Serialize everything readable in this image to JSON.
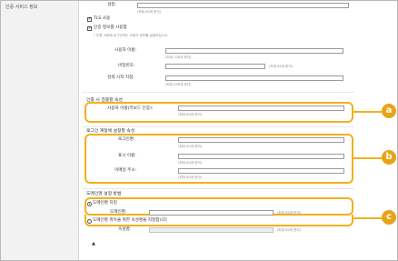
{
  "left_panel": {
    "label": "인증 서비스 정보"
  },
  "top": {
    "setting_label": "설정:",
    "setting_hint": "(최대 64개 문자)"
  },
  "tls": {
    "label": "TLS 사용",
    "checked": true
  },
  "auth_info": {
    "label": "인증 정보를 사용함",
    "checked": true,
    "note": "* 인증 서버에 로그인하는 사용자 정보를 설정하십시오.",
    "username_label": "사용자 이름:",
    "username_hint": "(최대 128개 문자)",
    "password_label": "비밀번호:",
    "password_hint": "(최대 64개 문자)",
    "search_start_label": "검색 시작 지점:",
    "search_start_hint": "(최대 256개 문자)"
  },
  "auth_attr": {
    "section_title": "인증 시 검증할 속성",
    "username_keyboard_label": "사용자 이름(키보드 인증):",
    "hint": "(최대 64개 문자)"
  },
  "login_account": {
    "section_title": "로그인 계정에 설정할 속성",
    "login_name_label": "로그인명:",
    "login_name_hint": "(최대 64개 문자)",
    "display_name_label": "표시 이름:",
    "display_name_hint": "(최대 64개 문자)",
    "email_label": "이메일 주소:",
    "email_hint": "(최대 64개 문자)"
  },
  "domain": {
    "section_title": "도메인명 설정 방법",
    "specify_label": "도메인명 지정",
    "specify_selected": true,
    "name_label": "도메인명:",
    "name_hint": "(최대 64개 문자)",
    "attr_option_label": "도메인명 취득을 위한 속성명을 지정합니다",
    "attr_selected": false,
    "attr_name_label": "속성명:",
    "attr_name_hint": "(최대 64개 문자)"
  },
  "callouts": {
    "a": "a",
    "b": "b",
    "c": "c",
    "color": "#e8a317"
  },
  "footer": {
    "mark": "▲"
  }
}
